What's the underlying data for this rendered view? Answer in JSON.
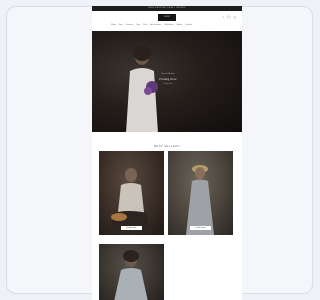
{
  "announcement": "FREE SHIPPING ON ALL ORDERS",
  "header": {
    "logo": "LOGO",
    "nav": [
      "Shop",
      "New",
      "Dresses",
      "Tops",
      "Sets",
      "Accessories",
      "Collections",
      "About",
      "Contact"
    ],
    "icons": [
      "search-icon",
      "account-icon",
      "bag-icon"
    ]
  },
  "hero": {
    "kicker": "New Collection",
    "title": "Evening Glow",
    "subtitle": "Shop now"
  },
  "section": {
    "title": "BEST SELLERS"
  },
  "products": [
    {
      "tag": "Quick view"
    },
    {
      "tag": "Quick view"
    },
    {
      "tag": ""
    }
  ]
}
